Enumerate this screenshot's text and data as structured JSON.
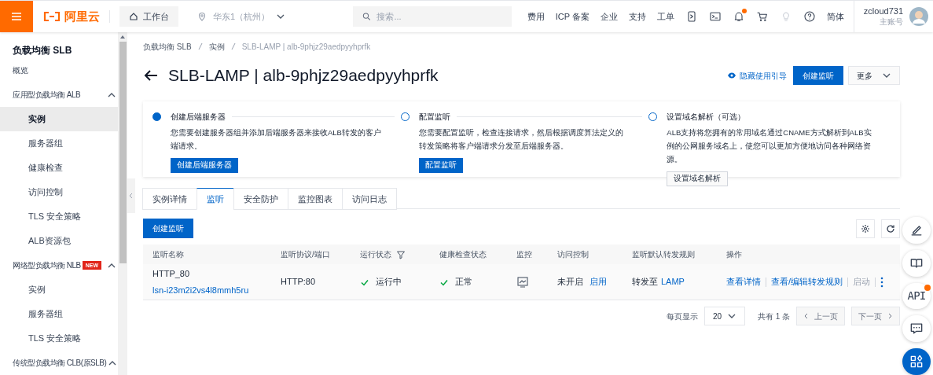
{
  "header": {
    "logo": "阿里云",
    "workbench": "工作台",
    "region": "华东1（杭州）",
    "search": {
      "placeholder": "搜索..."
    },
    "nav": [
      {
        "kind": "text",
        "label": "费用"
      },
      {
        "kind": "text",
        "label": "ICP 备案"
      },
      {
        "kind": "text",
        "label": "企业"
      },
      {
        "kind": "text",
        "label": "支持"
      },
      {
        "kind": "text",
        "label": "工单"
      },
      {
        "kind": "icon"
      },
      {
        "kind": "icon"
      },
      {
        "kind": "icon",
        "dot": true
      },
      {
        "kind": "icon"
      },
      {
        "kind": "icon"
      },
      {
        "kind": "icon"
      },
      {
        "kind": "text",
        "label": "简体"
      }
    ],
    "user": {
      "name": "zcloud731",
      "role": "主账号"
    }
  },
  "sidebar": {
    "title": "负载均衡 SLB",
    "items": [
      {
        "label": "概览"
      },
      {
        "label": "应用型负载均衡 ALB",
        "expanded": true,
        "children": [
          {
            "label": "实例",
            "selected": true
          },
          {
            "label": "服务器组",
            "selected": false
          },
          {
            "label": "健康检查",
            "selected": false
          },
          {
            "label": "访问控制",
            "selected": false
          },
          {
            "label": "TLS 安全策略",
            "selected": false
          },
          {
            "label": "ALB资源包",
            "selected": false
          }
        ]
      },
      {
        "label": "网络型负载均衡 NLB",
        "badge": "NEW",
        "expanded": true,
        "children": [
          {
            "label": "实例",
            "selected": false
          },
          {
            "label": "服务器组",
            "selected": false
          },
          {
            "label": "TLS 安全策略",
            "selected": false
          }
        ]
      },
      {
        "label": "传统型负载均衡 CLB(原SLB)",
        "expanded": true
      }
    ]
  },
  "breadcrumb": [
    "负载均衡 SLB",
    "实例",
    "SLB-LAMP | alb-9phjz29aedpyyhprfk"
  ],
  "title": "SLB-LAMP | alb-9phjz29aedpyyhprfk",
  "actions": {
    "guide": "隐藏使用引导",
    "primary": "创建监听",
    "more": "更多"
  },
  "steps": [
    {
      "title": "创建后端服务器",
      "text": "您需要创建服务器组并添加后端服务器来接收ALB转发的客户端请求。",
      "button": "创建后端服务器",
      "active": true
    },
    {
      "title": "配置监听",
      "text": "您需要配置监听，检查连接请求，然后根据调度算法定义的转发策略将客户端请求分发至后端服务器。",
      "button": "配置监听",
      "active": false
    },
    {
      "title": "设置域名解析（可选）",
      "text": "ALB支持将您拥有的常用域名通过CNAME方式解析到ALB实例的公网服务域名上，使您可以更加方便地访问各种网络资源。",
      "button": "设置域名解析",
      "active": false
    }
  ],
  "tabs": [
    {
      "label": "实例详情",
      "selected": false
    },
    {
      "label": "监听",
      "selected": true
    },
    {
      "label": "安全防护",
      "selected": false
    },
    {
      "label": "监控图表",
      "selected": false
    },
    {
      "label": "访问日志",
      "selected": false
    }
  ],
  "create_button": "创建监听",
  "table": {
    "columns": [
      "监听名称",
      "监听协议/端口",
      "运行状态",
      "健康检查状态",
      "监控",
      "访问控制",
      "监听默认转发规则",
      "操作"
    ],
    "rows": [
      {
        "name": "HTTP_80",
        "id": "lsn-i23m2i2vs4l8mmh5ru",
        "protocol": "HTTP:80",
        "status": "运行中",
        "health": "正常",
        "access": "未开启",
        "access_link": "启用",
        "rule": "转发至",
        "rule_link": "LAMP",
        "ops": [
          {
            "label": "查看详情",
            "disabled": false
          },
          {
            "label": "查看/编辑转发规则",
            "disabled": false
          },
          {
            "label": "启动",
            "disabled": true
          }
        ]
      }
    ]
  },
  "pagination": {
    "per_page_label": "每页显示",
    "per_page": "20",
    "total": "共有 1 条",
    "prev": {
      "label": "上一页",
      "disabled": true
    },
    "next": {
      "label": "下一页",
      "disabled": true
    }
  },
  "float_buttons": [
    {
      "primary": false
    },
    {
      "primary": false
    },
    {
      "label": "API",
      "dot": true,
      "primary": false
    },
    {
      "primary": false
    },
    {
      "primary": true
    }
  ]
}
